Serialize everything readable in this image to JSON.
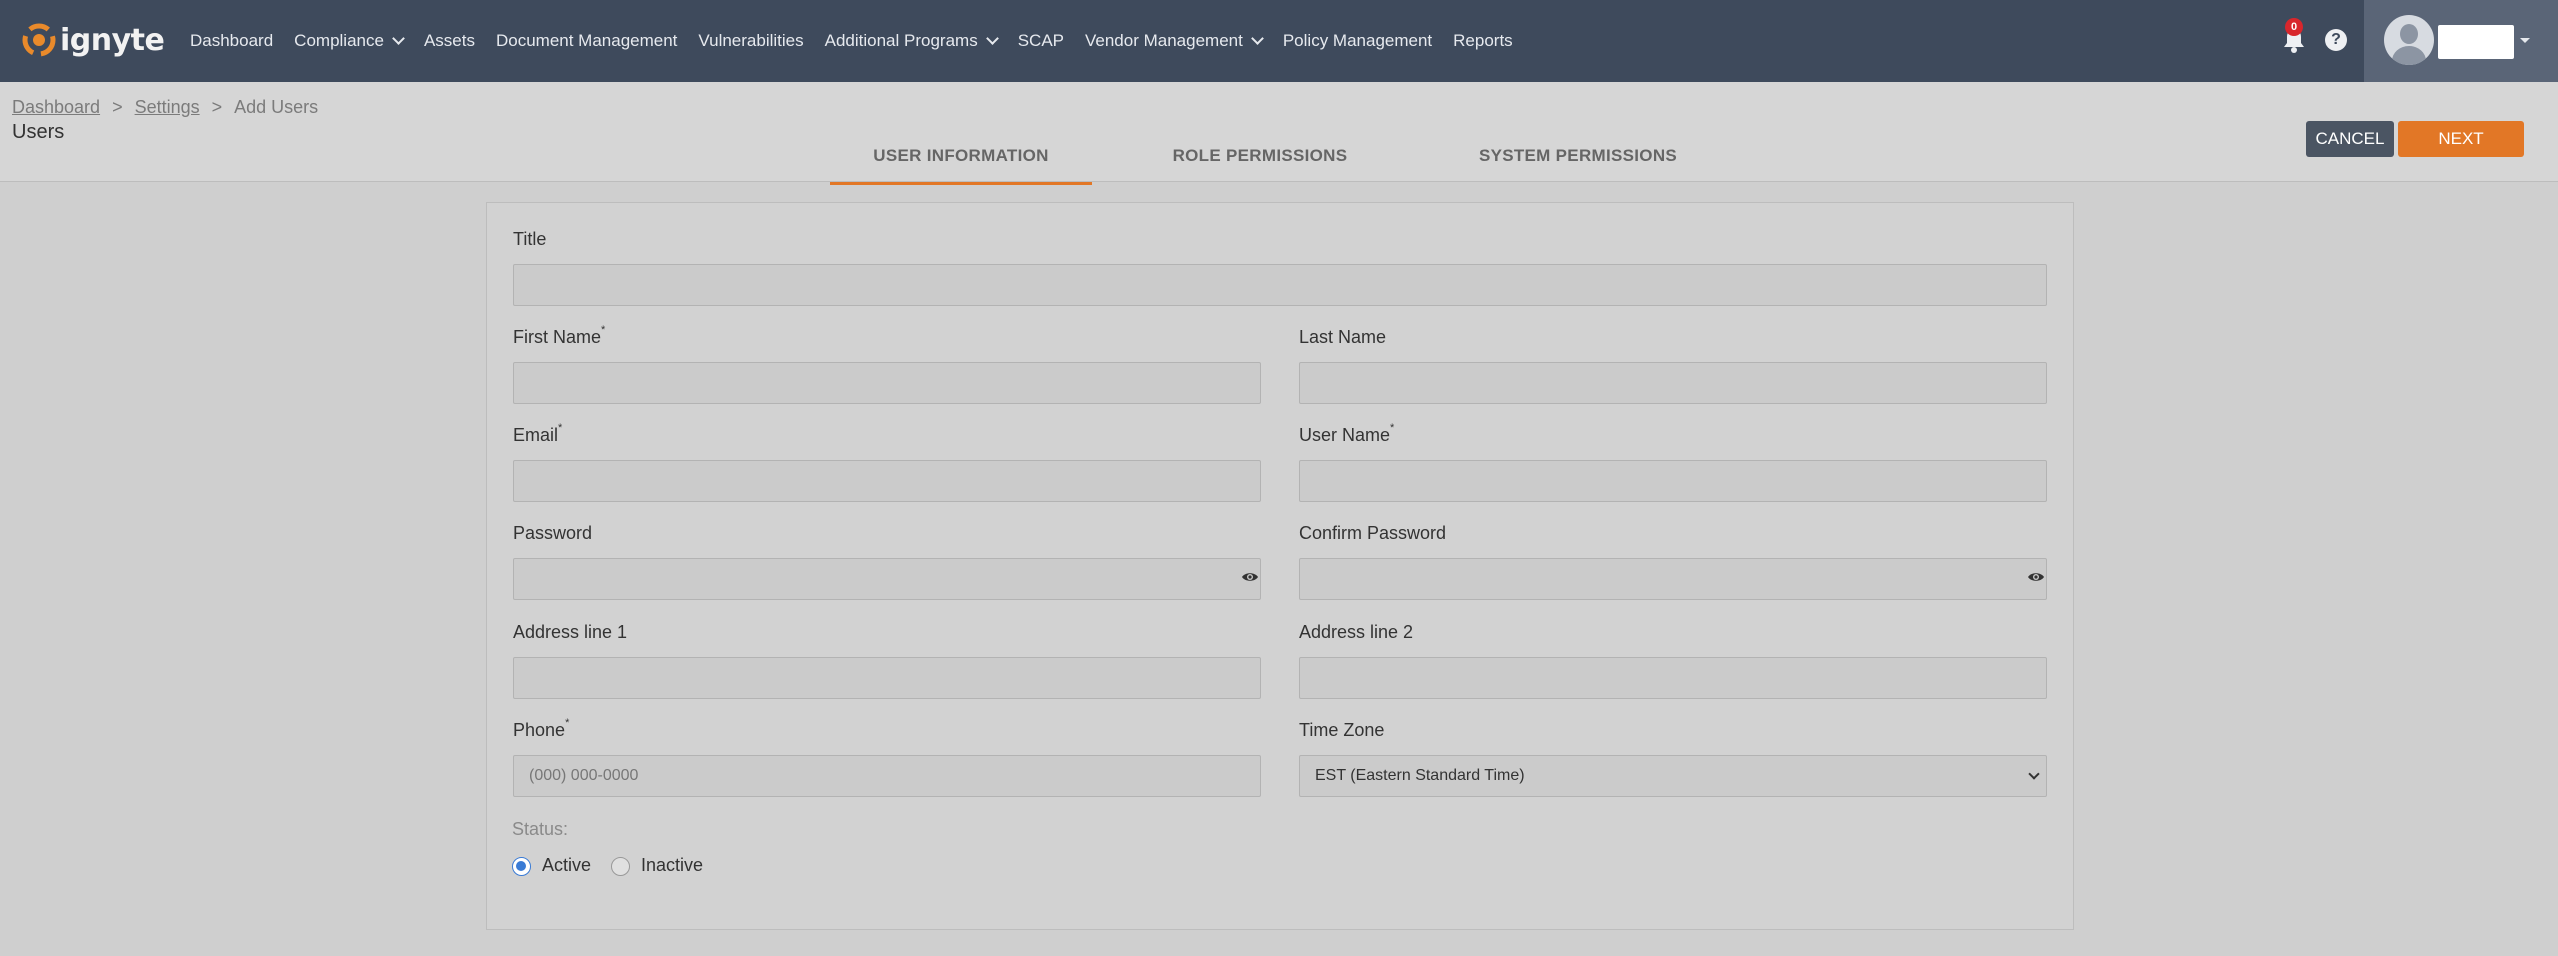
{
  "nav": {
    "logo_text": "ignyte",
    "items": [
      {
        "label": "Dashboard",
        "has_dropdown": false
      },
      {
        "label": "Compliance",
        "has_dropdown": true
      },
      {
        "label": "Assets",
        "has_dropdown": false
      },
      {
        "label": "Document Management",
        "has_dropdown": false
      },
      {
        "label": "Vulnerabilities",
        "has_dropdown": false
      },
      {
        "label": "Additional Programs",
        "has_dropdown": true
      },
      {
        "label": "SCAP",
        "has_dropdown": false
      },
      {
        "label": "Vendor Management",
        "has_dropdown": true
      },
      {
        "label": "Policy Management",
        "has_dropdown": false
      },
      {
        "label": "Reports",
        "has_dropdown": false
      }
    ],
    "notification_count": "0",
    "help_glyph": "?",
    "icons": {
      "bell": "bell-icon",
      "help": "help-icon",
      "user": "avatar-icon"
    }
  },
  "breadcrumb": {
    "items": [
      "Dashboard",
      "Settings",
      "Add Users"
    ],
    "separator": ">"
  },
  "page": {
    "title": "Users"
  },
  "tabs": [
    {
      "label": "USER INFORMATION",
      "active": true
    },
    {
      "label": "ROLE PERMISSIONS",
      "active": false
    },
    {
      "label": "SYSTEM PERMISSIONS",
      "active": false
    }
  ],
  "actions": {
    "cancel": "CANCEL",
    "next": "NEXT"
  },
  "form": {
    "title": {
      "label": "Title",
      "value": ""
    },
    "first_name": {
      "label": "First Name",
      "required": "*",
      "value": ""
    },
    "last_name": {
      "label": "Last Name",
      "value": ""
    },
    "email": {
      "label": "Email",
      "required": "*",
      "value": ""
    },
    "user_name": {
      "label": "User Name",
      "required": "*",
      "value": ""
    },
    "password": {
      "label": "Password",
      "value": ""
    },
    "confirm_password": {
      "label": "Confirm Password",
      "value": ""
    },
    "address1": {
      "label": "Address line 1",
      "value": ""
    },
    "address2": {
      "label": "Address line 2",
      "value": ""
    },
    "phone": {
      "label": "Phone",
      "required": "*",
      "placeholder": "(000) 000-0000",
      "value": ""
    },
    "time_zone": {
      "label": "Time Zone",
      "value": "EST (Eastern Standard Time)"
    },
    "status": {
      "label": "Status:",
      "options": [
        {
          "label": "Active",
          "checked": true
        },
        {
          "label": "Inactive",
          "checked": false
        }
      ]
    }
  },
  "colors": {
    "navbar": "#3e4a5c",
    "accent": "#e27726",
    "cancel_button": "#4b5563",
    "radio_checked": "#3a7bd5",
    "badge": "#d8262c"
  }
}
